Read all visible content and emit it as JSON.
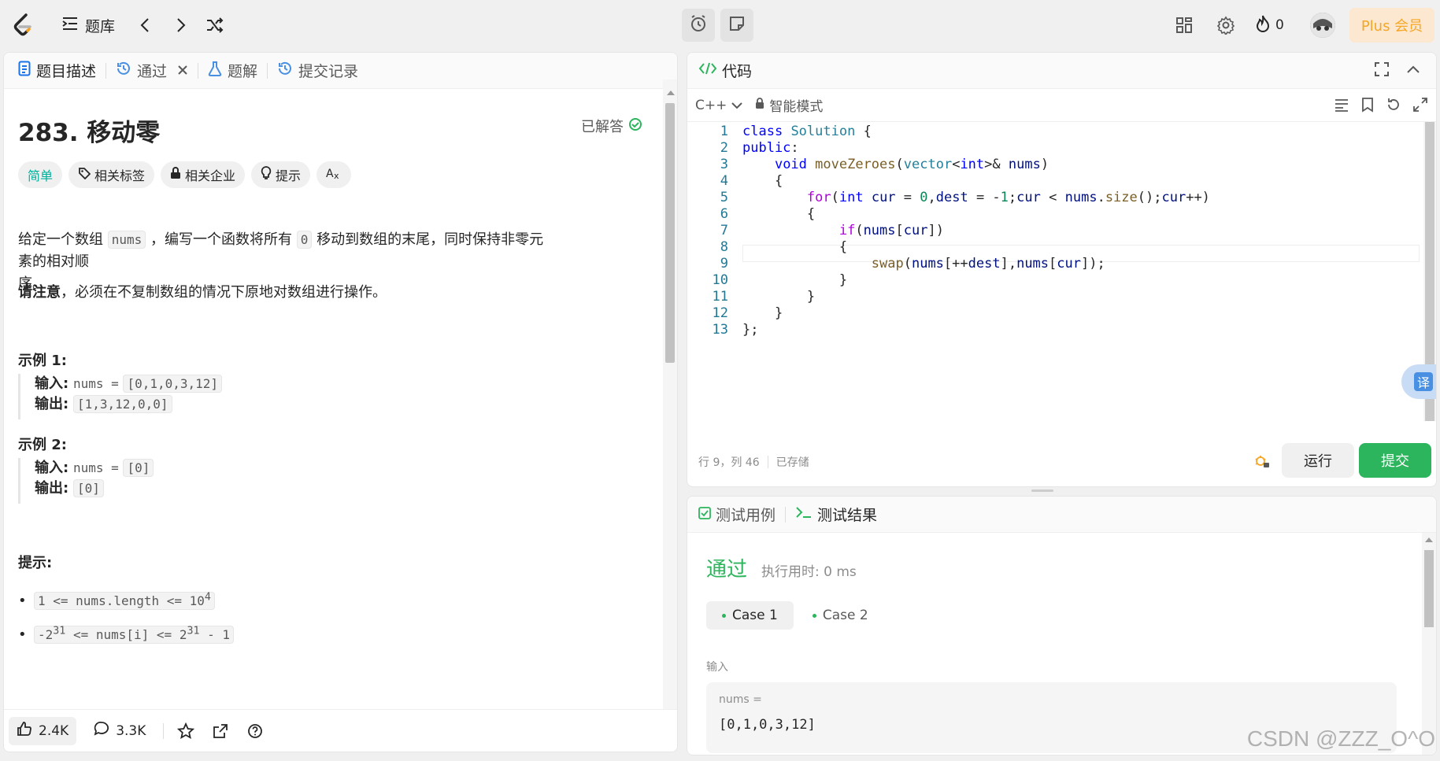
{
  "topbar": {
    "problemset_label": "题库",
    "streak_count": "0",
    "plus_label": "Plus 会员"
  },
  "left_tabs": [
    {
      "label": "题目描述"
    },
    {
      "label": "通过"
    },
    {
      "label": "题解"
    },
    {
      "label": "提交记录"
    }
  ],
  "problem": {
    "title": "283. 移动零",
    "status": "已解答",
    "difficulty": "简单",
    "tags": [
      "相关标签",
      "相关企业",
      "提示"
    ],
    "desc_part1": "给定一个数组",
    "desc_code1": "nums",
    "desc_part2": "，编写一个函数将所有",
    "desc_code2": "0",
    "desc_part3": "移动到数组的末尾，同时保持非零元素的相对顺",
    "desc_line2": "序。",
    "note_bold": "请注意",
    "note_text": "，必须在不复制数组的情况下原地对数组进行操作。",
    "ex1_title": "示例 1:",
    "ex1_in_label": "输入:",
    "ex1_in_var": "nums =",
    "ex1_in_val": "[0,1,0,3,12]",
    "ex1_out_label": "输出:",
    "ex1_out_val": "[1,3,12,0,0]",
    "ex2_title": "示例 2:",
    "ex2_in_label": "输入:",
    "ex2_in_var": "nums =",
    "ex2_in_val": "[0]",
    "ex2_out_label": "输出:",
    "ex2_out_val": "[0]",
    "hints_title": "提示:",
    "c1_a": "1 <= nums.length <= 10",
    "c1_sup": "4",
    "c2_a": "-2",
    "c2_sup1": "31",
    "c2_b": " <= nums[i] <= 2",
    "c2_sup2": "31",
    "c2_c": " - 1"
  },
  "bottom_bar": {
    "likes": "2.4K",
    "comments": "3.3K"
  },
  "code_panel": {
    "title": "代码",
    "language": "C++",
    "mode": "智能模式",
    "status_pos": "行 9，列 46",
    "status_saved": "已存储",
    "run_label": "运行",
    "submit_label": "提交",
    "translate_label": "译"
  },
  "code_lines": [
    "1",
    "2",
    "3",
    "4",
    "5",
    "6",
    "7",
    "8",
    "9",
    "10",
    "11",
    "12",
    "13"
  ],
  "result_panel": {
    "tab_testcase": "测试用例",
    "tab_result": "测试结果",
    "status": "通过",
    "runtime": "执行用时: 0 ms",
    "case1": "Case 1",
    "case2": "Case 2",
    "input_label": "输入",
    "var_name": "nums =",
    "var_value": "[0,1,0,3,12]"
  },
  "watermark": "CSDN @ZZZ_O^O",
  "colors": {
    "green": "#2db55d",
    "accent_plus": "#f5a623",
    "code_blue": "#0000ff"
  }
}
